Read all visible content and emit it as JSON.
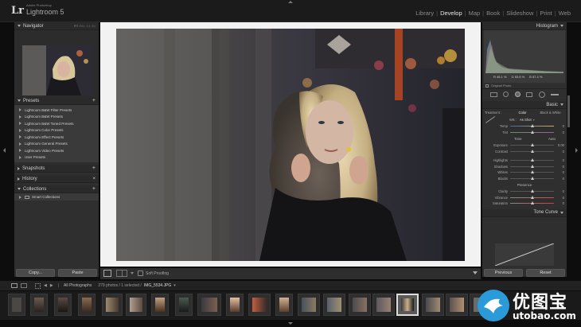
{
  "app": {
    "vendor": "Adobe Photoshop",
    "name": "Lightroom 5",
    "logo": "Lr"
  },
  "modules": [
    {
      "label": "Library",
      "active": false
    },
    {
      "label": "Develop",
      "active": true
    },
    {
      "label": "Map",
      "active": false
    },
    {
      "label": "Book",
      "active": false
    },
    {
      "label": "Slideshow",
      "active": false
    },
    {
      "label": "Print",
      "active": false
    },
    {
      "label": "Web",
      "active": false
    }
  ],
  "left": {
    "navigator": {
      "title": "Navigator",
      "zoom": [
        "FIT",
        "FILL",
        "1:1",
        "3:1"
      ]
    },
    "presets": {
      "title": "Presets",
      "items": [
        "Lightroom B&W Filter Presets",
        "Lightroom B&W Presets",
        "Lightroom B&W Toned Presets",
        "Lightroom Color Presets",
        "Lightroom Effect Presets",
        "Lightroom General Presets",
        "Lightroom Video Presets",
        "User Presets"
      ]
    },
    "snapshots": {
      "title": "Snapshots"
    },
    "history": {
      "title": "History"
    },
    "collections": {
      "title": "Collections",
      "items": [
        "Smart Collections"
      ]
    },
    "copy_label": "Copy...",
    "paste_label": "Paste"
  },
  "toolbar": {
    "soft_proofing": "Soft Proofing"
  },
  "right": {
    "histogram": {
      "title": "Histogram",
      "r": "46.1",
      "g": "53.6",
      "b": "57.4",
      "original_photo": "Original Photo"
    },
    "basic": {
      "title": "Basic",
      "treatment_label": "Treatment :",
      "color": "Color",
      "bw": "Black & White",
      "wb_label": "WB :",
      "wb_value": "As Shot",
      "tone": "Tone",
      "auto": "Auto",
      "presence": "Presence",
      "sliders": [
        {
          "label": "Temp",
          "value": "0"
        },
        {
          "label": "Tint",
          "value": "0"
        },
        {
          "label": "Exposure",
          "value": "0.00"
        },
        {
          "label": "Contrast",
          "value": "0"
        },
        {
          "label": "Highlights",
          "value": "0"
        },
        {
          "label": "Shadows",
          "value": "0"
        },
        {
          "label": "Whites",
          "value": "0"
        },
        {
          "label": "Blacks",
          "value": "0"
        },
        {
          "label": "Clarity",
          "value": "0"
        },
        {
          "label": "Vibrance",
          "value": "0"
        },
        {
          "label": "Saturation",
          "value": "0"
        }
      ]
    },
    "tone_curve": {
      "title": "Tone Curve"
    },
    "previous_label": "Previous",
    "reset_label": "Reset"
  },
  "filmstrip": {
    "source": "All Photographs",
    "status": "279 photos / 1 selected /",
    "filename": "IMG_5534.JPG"
  },
  "watermark": {
    "chinese": "优图宝",
    "domain": "utobao.com"
  }
}
